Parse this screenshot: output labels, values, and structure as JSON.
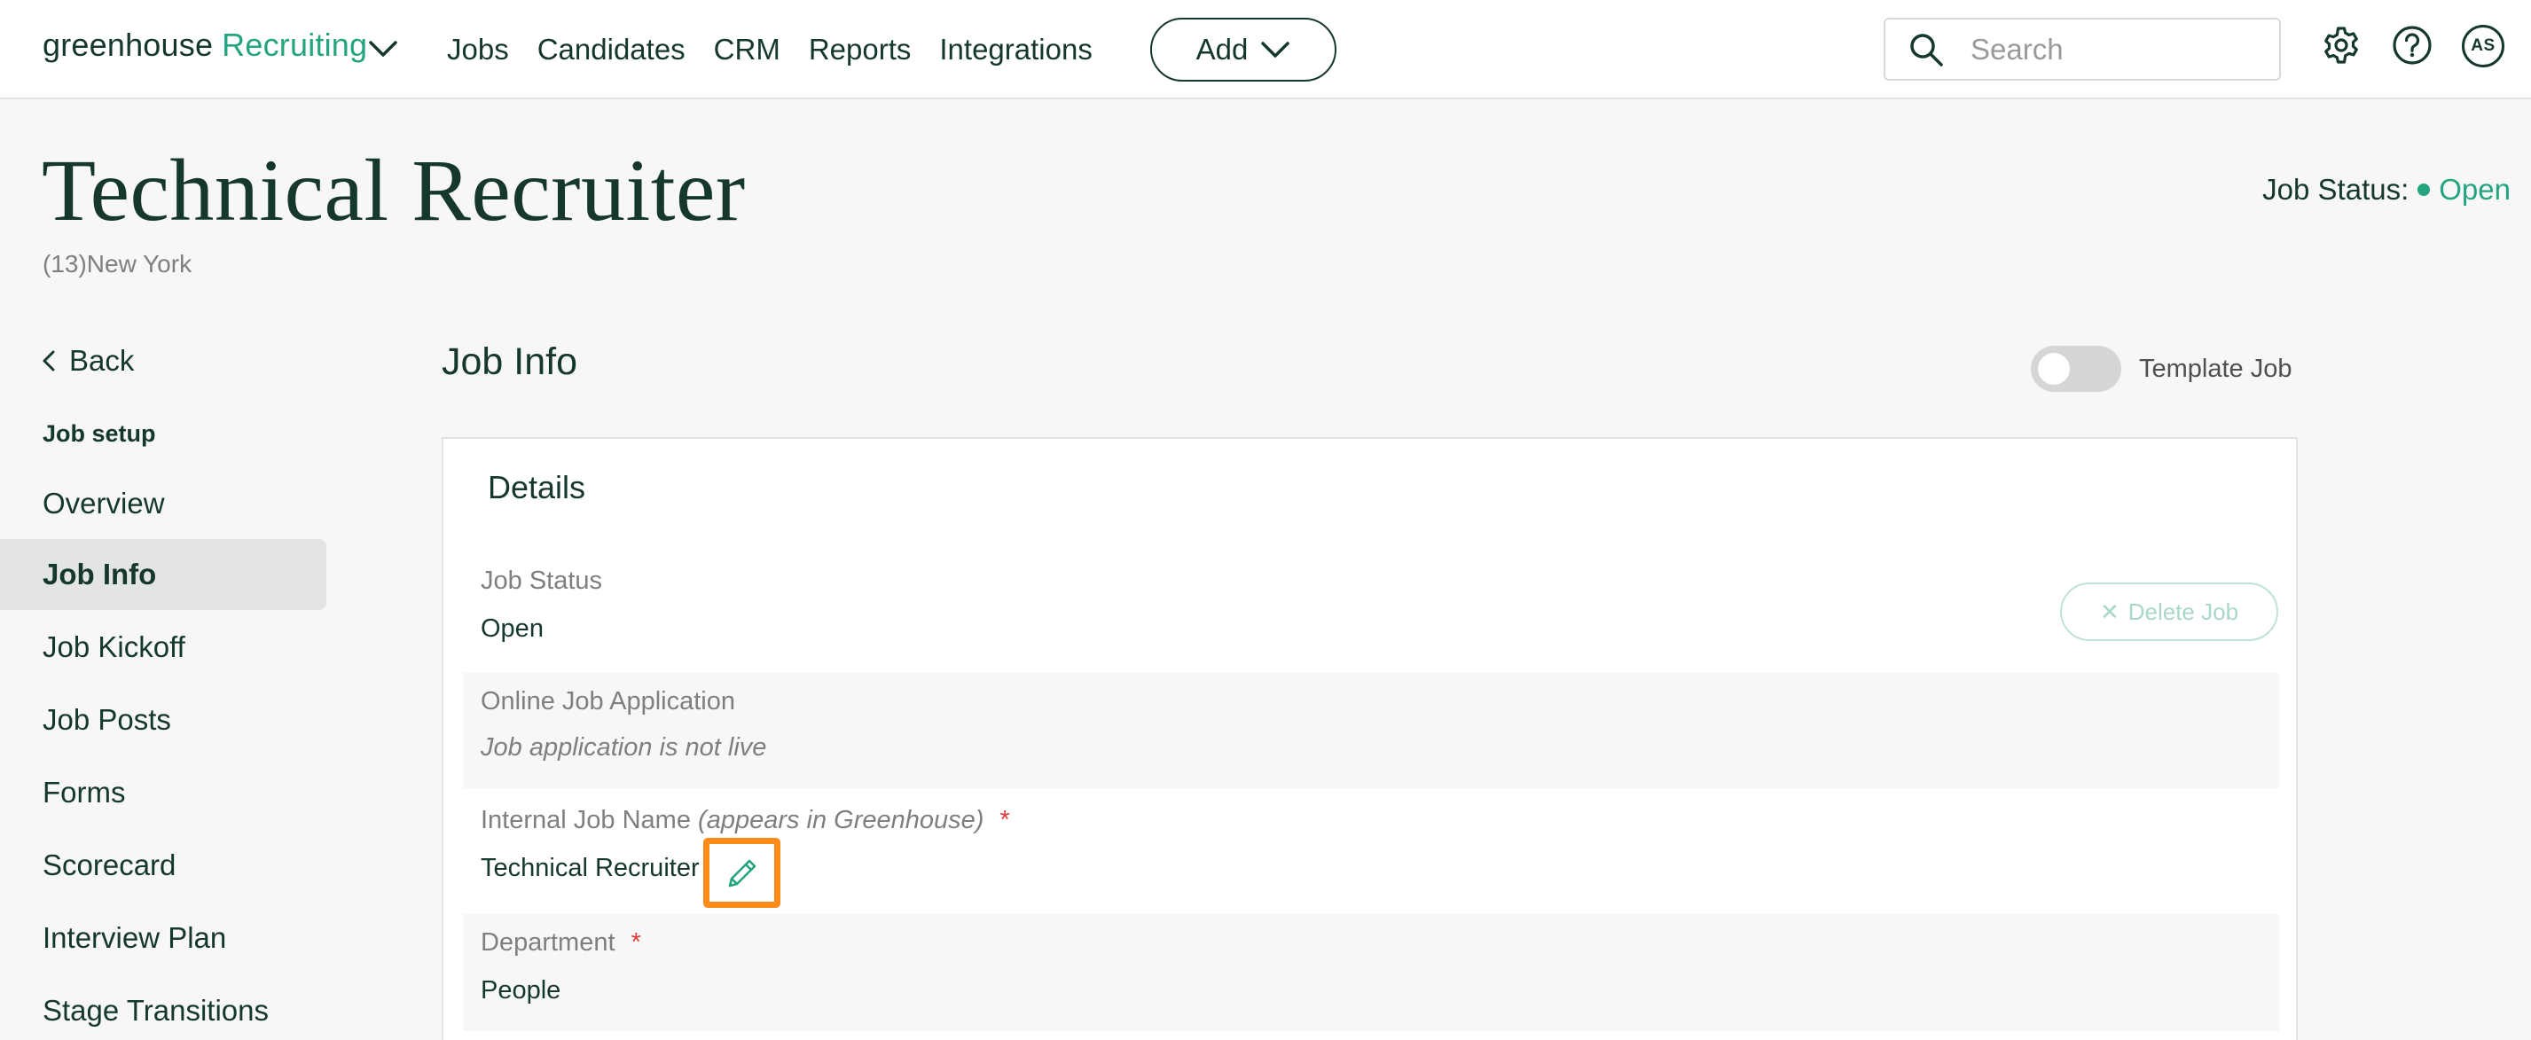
{
  "nav": {
    "logo_primary": "greenhouse",
    "logo_secondary": "Recruiting",
    "links": [
      "Jobs",
      "Candidates",
      "CRM",
      "Reports",
      "Integrations"
    ],
    "add_label": "Add",
    "search_placeholder": "Search",
    "avatar_initials": "AS"
  },
  "header": {
    "title": "Technical Recruiter",
    "subtitle": "(13)New York",
    "status_label": "Job Status:",
    "status_value": "Open"
  },
  "sidebar": {
    "back_label": "Back",
    "section_label": "Job setup",
    "items": [
      {
        "label": "Overview"
      },
      {
        "label": "Job Info",
        "active": true
      },
      {
        "label": "Job Kickoff"
      },
      {
        "label": "Job Posts"
      },
      {
        "label": "Forms"
      },
      {
        "label": "Scorecard"
      },
      {
        "label": "Interview Plan"
      },
      {
        "label": "Stage Transitions"
      }
    ]
  },
  "main": {
    "title": "Job Info",
    "template_toggle_label": "Template Job",
    "template_toggle_on": false,
    "card_title": "Details",
    "delete_label": "Delete Job",
    "fields": {
      "job_status": {
        "label": "Job Status",
        "value": "Open"
      },
      "online_application": {
        "label": "Online Job Application",
        "value": "Job application is not live"
      },
      "internal_name": {
        "label": "Internal Job Name",
        "label_note": "(appears in Greenhouse)",
        "required_mark": "*",
        "value": "Technical Recruiter"
      },
      "department": {
        "label": "Department",
        "required_mark": "*",
        "value": "People"
      }
    }
  },
  "colors": {
    "brand_dark": "#15372c",
    "brand_green": "#24a47f",
    "highlight_orange": "#ff8c1a",
    "required_red": "#e03b3b"
  }
}
